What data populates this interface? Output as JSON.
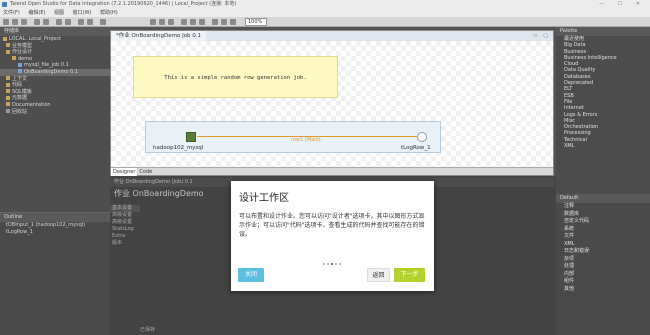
{
  "window": {
    "title": "Talend Open Studio for Data Integration (7.2.1.20190620_1446) | Local_Project (连接: 本地)"
  },
  "menu": [
    "文件(F)",
    "编辑(E)",
    "视图",
    "窗口(W)",
    "帮助(H)"
  ],
  "toolbar": {
    "zoom": "100%"
  },
  "repository": {
    "tab": "存储库",
    "rows": [
      "LOCAL: Local_Project",
      "业务模型",
      "作业设计",
      "demo",
      "mysql_file_job 0.1",
      "OnBoardingDemo 0.1",
      "上下文",
      "代码",
      "SQL模板",
      "元数据",
      "Documentation",
      "回收站"
    ]
  },
  "outline": {
    "tab": "Outline",
    "rows": [
      "tDBInput_1 (hadoop102_mysql)",
      "tLogRow_1"
    ]
  },
  "editor": {
    "tab": "*作业 OnBoardingDemo Job 0.1",
    "note": "This is a simple random row generation job.",
    "component1": "hadoop102_mysql",
    "component2": "tLogRow_1",
    "flow_label": "row1 (Main)",
    "tab_designer": "Designer",
    "tab_code": "Code"
  },
  "palette": {
    "tab": "Palette",
    "items": [
      "最近使用",
      "Big Data",
      "Business",
      "Business Intelligence",
      "Cloud",
      "Data Quality",
      "Databases",
      "Deprecated",
      "ELT",
      "ESB",
      "File",
      "Internet",
      "Logs & Errors",
      "Misc",
      "Orchestration",
      "Processing",
      "Technical",
      "XML"
    ]
  },
  "palette_lower": {
    "head": "Default",
    "rows": [
      "注释",
      "数据库",
      "自定义代码",
      "系统",
      "文件",
      "XML",
      "日志和错误",
      "杂项",
      "处理",
      "内部",
      "组件",
      "其他"
    ]
  },
  "bottom": {
    "tabs": "作业 OnBoardingDemo (Job) 0.1",
    "title": "作业 OnBoardingDemo",
    "side": [
      "基本设置",
      "高级设置",
      "高级设置",
      "StatsLog",
      "Extra",
      "版本"
    ],
    "status": "已保存"
  },
  "modal": {
    "title": "设计工作区",
    "body": "可以布置和设计作业。您可以访问\"设计者\"选项卡，其中以图形方式显示作业；可以访问\"代码\"选项卡，查看生成的代码并查找可能存在的错误。",
    "close": "关闭",
    "back": "返回",
    "next": "下一步"
  }
}
